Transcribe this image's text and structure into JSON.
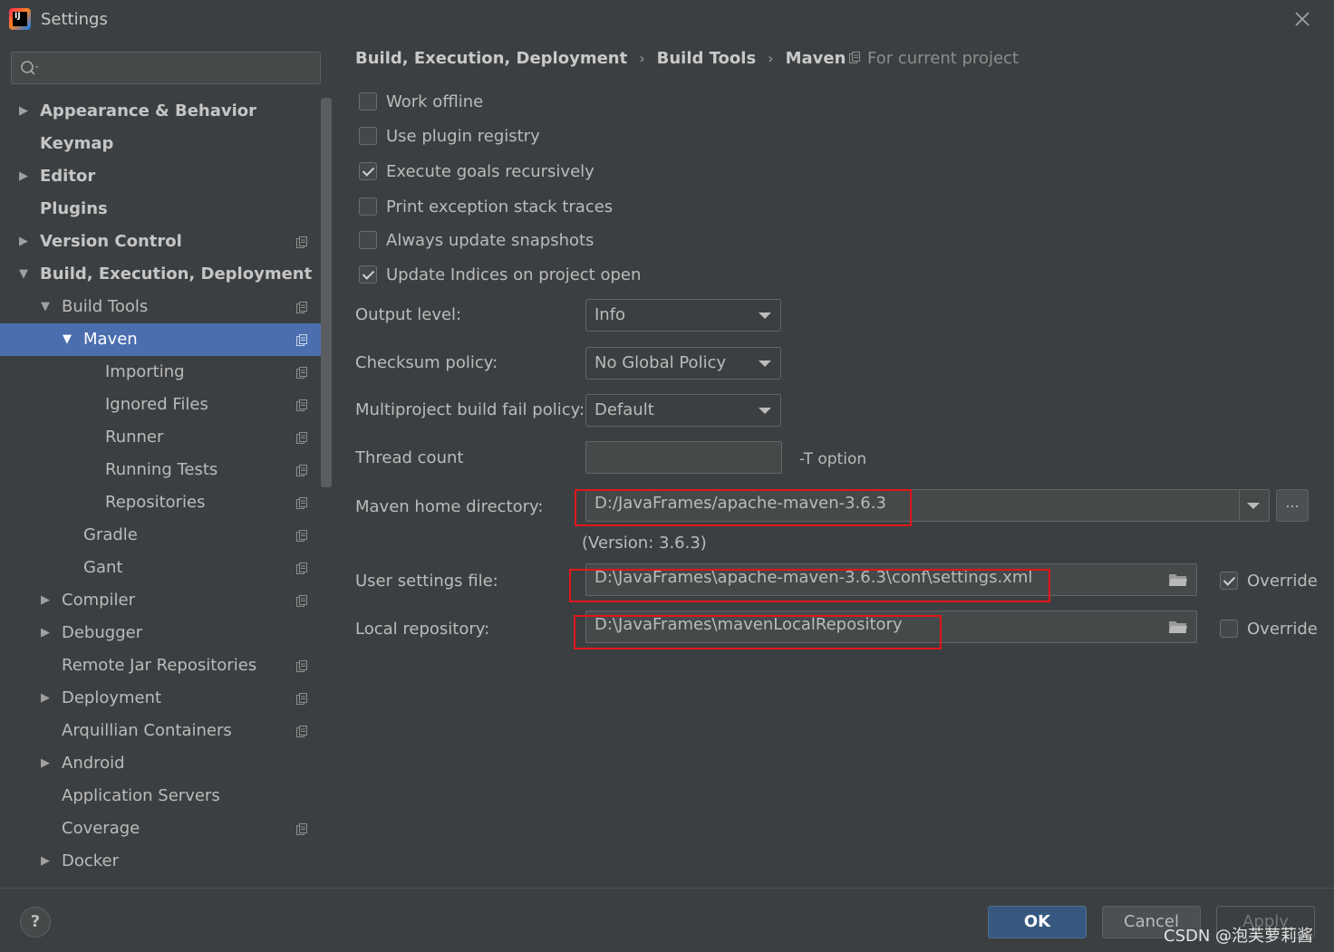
{
  "window": {
    "title": "Settings",
    "app_icon_text": "IJ"
  },
  "sidebar": {
    "search_placeholder": "",
    "items": [
      {
        "label": "Appearance & Behavior"
      },
      {
        "label": "Keymap"
      },
      {
        "label": "Editor"
      },
      {
        "label": "Plugins"
      },
      {
        "label": "Version Control"
      },
      {
        "label": "Build, Execution, Deployment"
      },
      {
        "label": "Build Tools"
      },
      {
        "label": "Maven"
      },
      {
        "label": "Importing"
      },
      {
        "label": "Ignored Files"
      },
      {
        "label": "Runner"
      },
      {
        "label": "Running Tests"
      },
      {
        "label": "Repositories"
      },
      {
        "label": "Gradle"
      },
      {
        "label": "Gant"
      },
      {
        "label": "Compiler"
      },
      {
        "label": "Debugger"
      },
      {
        "label": "Remote Jar Repositories"
      },
      {
        "label": "Deployment"
      },
      {
        "label": "Arquillian Containers"
      },
      {
        "label": "Android"
      },
      {
        "label": "Application Servers"
      },
      {
        "label": "Coverage"
      },
      {
        "label": "Docker"
      }
    ]
  },
  "breadcrumb": {
    "part1": "Build, Execution, Deployment",
    "sep": "›",
    "part2": "Build Tools",
    "part3": "Maven"
  },
  "for_current_project": "For current project",
  "checkboxes": {
    "work_offline": {
      "label": "Work offline",
      "checked": false
    },
    "use_plugin_registry": {
      "label": "Use plugin registry",
      "checked": false
    },
    "execute_goals": {
      "label": "Execute goals recursively",
      "checked": true
    },
    "print_exception": {
      "label": "Print exception stack traces",
      "checked": false
    },
    "always_update": {
      "label": "Always update snapshots",
      "checked": false
    },
    "update_indices": {
      "label": "Update Indices on project open",
      "checked": true
    }
  },
  "fields": {
    "output_level": {
      "label": "Output level:",
      "value": "Info"
    },
    "checksum_policy": {
      "label": "Checksum policy:",
      "value": "No Global Policy"
    },
    "multiproject_policy": {
      "label": "Multiproject build fail policy:",
      "value": "Default"
    },
    "thread_count": {
      "label": "Thread count",
      "value": "",
      "note": "-T option"
    },
    "maven_home": {
      "label": "Maven home directory:",
      "value": "D:/JavaFrames/apache-maven-3.6.3",
      "browse": "...",
      "version": "(Version: 3.6.3)"
    },
    "user_settings": {
      "label": "User settings file:",
      "value": "D:\\JavaFrames\\apache-maven-3.6.3\\conf\\settings.xml",
      "override_label": "Override",
      "override_checked": true
    },
    "local_repo": {
      "label": "Local repository:",
      "value": "D:\\JavaFrames\\mavenLocalRepository",
      "override_label": "Override",
      "override_checked": false
    }
  },
  "buttons": {
    "help": "?",
    "ok": "OK",
    "cancel": "Cancel",
    "apply": "Apply"
  },
  "watermark": "CSDN @泡芙萝莉酱",
  "colors": {
    "background": "#3c3f41",
    "selection": "#4b6eaf",
    "ok_button": "#365880",
    "annotation_red": "#e0161c"
  }
}
